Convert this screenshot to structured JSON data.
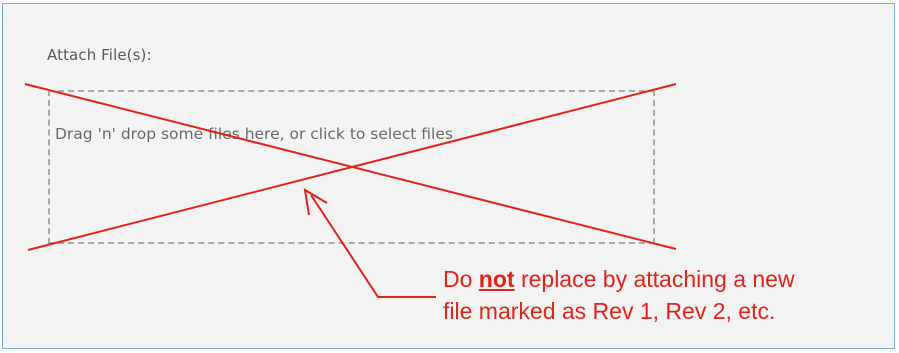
{
  "attach": {
    "label": "Attach File(s):",
    "dropzone_text": "Drag 'n' drop some files here, or click to select files"
  },
  "annotation": {
    "line1_before": "Do ",
    "line1_emphasis": "not",
    "line1_after": " replace by attaching a new",
    "line2": "file marked as Rev 1, Rev 2, etc.",
    "color": "#e2231a"
  },
  "icons": [
    "cross-out-mark",
    "callout-arrow"
  ]
}
